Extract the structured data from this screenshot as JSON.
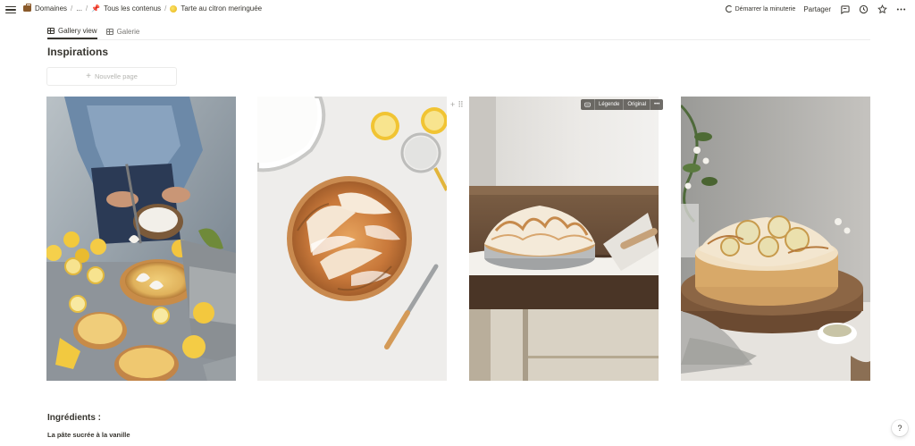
{
  "breadcrumbs": [
    {
      "label": "Domaines",
      "icon": "briefcase-icon"
    },
    {
      "label": "..."
    },
    {
      "label": "Tous les contenus",
      "icon": "pushpin-icon"
    },
    {
      "label": "Tarte au citron meringuée",
      "icon": "lemon-icon"
    }
  ],
  "top_actions": {
    "timer_label": "Démarrer la minuterie",
    "share_label": "Partager",
    "icons": [
      "comment-icon",
      "history-icon",
      "star-icon",
      "more-icon"
    ]
  },
  "tabs": [
    {
      "label": "Gallery view",
      "active": true
    },
    {
      "label": "Galerie",
      "active": false
    }
  ],
  "section_title": "Inspirations",
  "new_page_label": "Nouvelle page",
  "gallery": {
    "cards": [
      {
        "name": "lemon-tart-preparation-photo"
      },
      {
        "name": "meringue-tart-top-view-photo"
      },
      {
        "name": "lemon-meringue-pie-table-photo"
      },
      {
        "name": "lemon-meringue-cake-photo"
      }
    ],
    "overlay": {
      "caption_label": "Légende",
      "original_label": "Original",
      "more": "•••"
    }
  },
  "ingredients_heading": "Ingrédients :",
  "pate_heading": "La pâte sucrée à la vanille",
  "help_label": "?"
}
